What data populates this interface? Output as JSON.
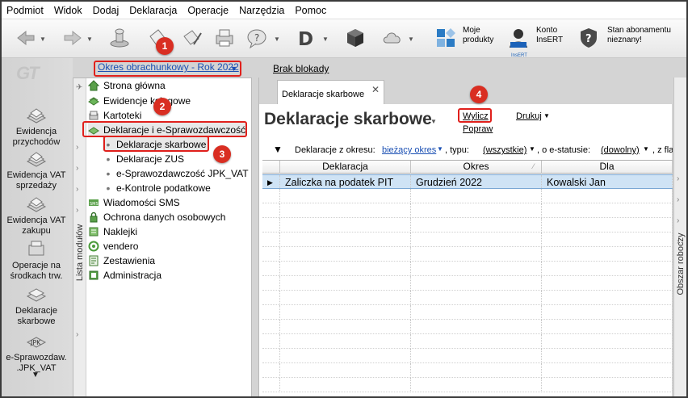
{
  "menu": [
    "Podmiot",
    "Widok",
    "Dodaj",
    "Deklaracja",
    "Operacje",
    "Narzędzia",
    "Pomoc"
  ],
  "toolbar": {
    "moje_produkty": "Moje\nprodukty",
    "konto": "Konto\nInsERT",
    "stan": "Stan abonamentu\nnieznany!",
    "insert_mini": "InsERT"
  },
  "period": {
    "label": "Okres obrachunkowy - Rok 2022",
    "brak": "Brak blokady"
  },
  "leftnav": {
    "logo": "GT",
    "items": [
      "Ewidencja\nprzychodów",
      "Ewidencja VAT\nsprzedaży",
      "Ewidencja VAT\nzakupu",
      "Operacje na\nśrodkach trw.",
      "Deklaracje\nskarbowe",
      "e-Sprawozdaw.\n.JPK_VAT"
    ],
    "jpk_icon_text": "JPK"
  },
  "modules": {
    "vertical_label": "Lista modułów",
    "items": [
      {
        "label": "Strona główna",
        "icon": "house-icon"
      },
      {
        "label": "Ewidencje księgowe",
        "icon": "book-icon"
      },
      {
        "label": "Kartoteki",
        "icon": "files-icon"
      },
      {
        "label": "Deklaracje i e-Sprawozdawczość",
        "icon": "declaration-icon"
      },
      {
        "label": "Deklaracje skarbowe",
        "icon": "dot"
      },
      {
        "label": "Deklaracje ZUS",
        "icon": "dot"
      },
      {
        "label": "e-Sprawozdawczość JPK_VAT",
        "icon": "dot"
      },
      {
        "label": "e-Kontrole podatkowe",
        "icon": "dot"
      },
      {
        "label": "Wiadomości SMS",
        "icon": "sms-icon"
      },
      {
        "label": "Ochrona danych osobowych",
        "icon": "lock-icon"
      },
      {
        "label": "Naklejki",
        "icon": "label-icon"
      },
      {
        "label": "vendero",
        "icon": "vendero-icon"
      },
      {
        "label": "Zestawienia",
        "icon": "report-icon"
      },
      {
        "label": "Administracja",
        "icon": "admin-icon"
      }
    ]
  },
  "main": {
    "tab": "Deklaracje skarbowe",
    "title": "Deklaracje skarbowe",
    "wylicz": "Wylicz",
    "popraw": "Popraw",
    "drukuj": "Drukuj",
    "filters": {
      "label1": "Deklaracje z okresu:",
      "value1": "bieżący okres",
      "label2": ", typu:",
      "value2": "(wszystkie)",
      "label3": ", o e-statusie:",
      "value3": "(dowolny)",
      "label4": ", z fla"
    },
    "columns": [
      "Deklaracja",
      "Okres",
      "Dla"
    ],
    "rows": [
      [
        "Zaliczka na podatek PIT",
        "Grudzień 2022",
        "Kowalski Jan"
      ]
    ]
  },
  "workarea": "Obszar roboczy",
  "badges": [
    "1",
    "2",
    "3",
    "4"
  ],
  "colors": {
    "highlight": "#e0201c",
    "badge": "#d92e22",
    "link": "#1a4fb3",
    "row_selected": "#cfe3f5"
  }
}
